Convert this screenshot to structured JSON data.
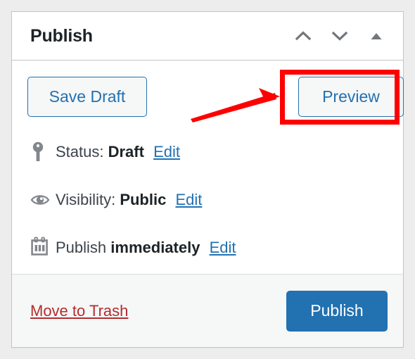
{
  "panel": {
    "title": "Publish",
    "header_icons": [
      {
        "name": "chevron-up-icon",
        "label": "Move up"
      },
      {
        "name": "chevron-down-icon",
        "label": "Move down"
      },
      {
        "name": "triangle-up-icon",
        "label": "Toggle panel"
      }
    ],
    "icon_color": "#72777c"
  },
  "actions": {
    "save_draft_label": "Save Draft",
    "preview_label": "Preview",
    "publish_label": "Publish",
    "move_to_trash_label": "Move to Trash"
  },
  "status_rows": [
    {
      "icon": "post-status-pin-icon",
      "prefix": "Status:",
      "value": "Draft",
      "edit_label": "Edit"
    },
    {
      "icon": "eye-visibility-icon",
      "prefix": "Visibility:",
      "value": "Public",
      "edit_label": "Edit"
    },
    {
      "icon": "calendar-icon",
      "prefix": "Publish",
      "value": "immediately",
      "edit_label": "Edit"
    }
  ],
  "colors": {
    "page_background": "#ededed",
    "panel_background": "#ffffff",
    "panel_border": "#c3c4c7",
    "footer_background": "#f6f7f7",
    "primary_blue": "#2271b1",
    "trash_red": "#b32d2e",
    "annotation_red": "#ff0000",
    "text_dark": "#1d2327",
    "text_body": "#3c434a",
    "icon_gray": "#72777c"
  },
  "annotations": {
    "highlight_target": "preview-button",
    "arrow_points_to": "preview-button"
  }
}
